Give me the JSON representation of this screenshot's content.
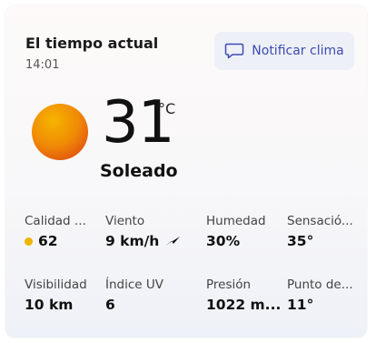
{
  "header": {
    "title": "El tiempo actual",
    "time": "14:01",
    "notify_label": "Notificar clima"
  },
  "current": {
    "temperature": "31",
    "unit": "°C",
    "condition": "Soleado",
    "icon": "sun-icon"
  },
  "details": {
    "air_quality": {
      "label": "Calidad ...",
      "value": "62",
      "status_color": "#f0b400"
    },
    "wind": {
      "label": "Viento",
      "value": "9 km/h",
      "icon": "wind-direction-arrow-icon"
    },
    "humidity": {
      "label": "Humedad",
      "value": "30%"
    },
    "feels_like": {
      "label": "Sensació...",
      "value": "35°"
    },
    "visibility": {
      "label": "Visibilidad",
      "value": "10 km"
    },
    "uv_index": {
      "label": "Índice UV",
      "value": "6"
    },
    "pressure": {
      "label": "Presión",
      "value": "1022 m..."
    },
    "dew_point": {
      "label": "Punto de...",
      "value": "11°"
    }
  },
  "colors": {
    "accent": "#3c4bb2",
    "sun_outer": "#f0a100",
    "sun_inner": "#e9650d"
  }
}
